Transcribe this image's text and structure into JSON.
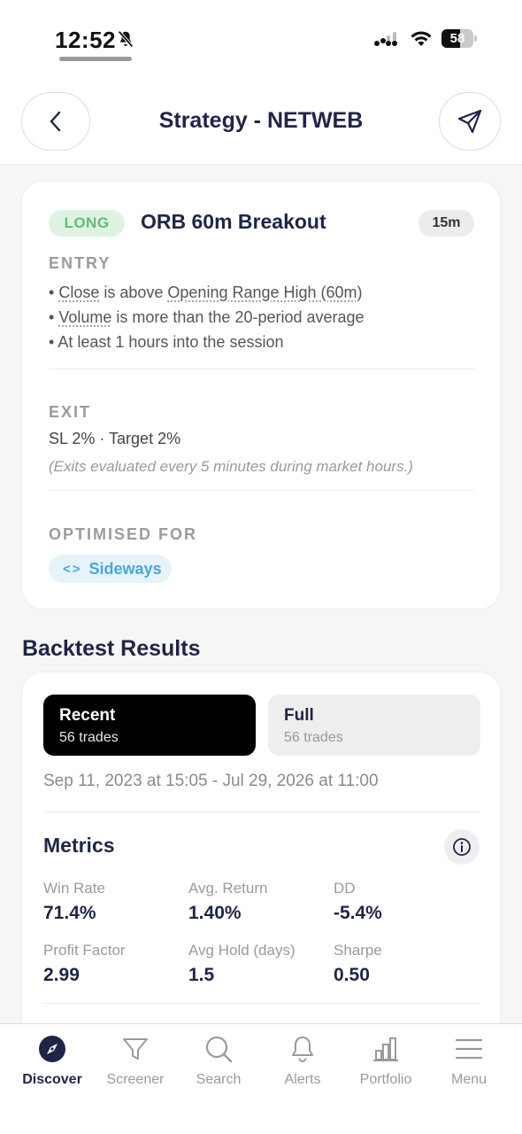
{
  "status_bar": {
    "time": "12:52",
    "battery_level": "58",
    "battery_fraction": 0.58
  },
  "header": {
    "title": "Strategy - NETWEB",
    "back_icon": "chevron-left-icon",
    "share_icon": "send-icon"
  },
  "strategy": {
    "direction": "LONG",
    "name": "ORB 60m Breakout",
    "timeframe": "15m",
    "entry": {
      "label": "ENTRY",
      "rules": [
        {
          "bullet": "•",
          "a": "Close",
          "b": " is above ",
          "c": "Opening Range High (60m)",
          "d": ""
        },
        {
          "bullet": "•",
          "a": "Volume",
          "b": " is more than the 20-period average",
          "c": "",
          "d": ""
        },
        {
          "bullet": "•",
          "a": "",
          "b": "At least 1 hours into the session",
          "c": "",
          "d": ""
        }
      ]
    },
    "exit": {
      "label": "EXIT",
      "text": "SL 2% · Target 2%",
      "note": "(Exits evaluated every 5 minutes during market hours.)"
    },
    "optimised": {
      "label": "OPTIMISED FOR",
      "chip_icon": "<>",
      "chip_label": "Sideways"
    }
  },
  "backtest": {
    "title": "Backtest Results",
    "tabs": [
      {
        "label": "Recent",
        "sub": "56 trades"
      },
      {
        "label": "Full",
        "sub": "56 trades"
      }
    ],
    "date_range": "Sep 11, 2023 at 15:05 - Jul 29, 2026 at 11:00",
    "metrics_title": "Metrics",
    "metrics": [
      {
        "label": "Win Rate",
        "value": "71.4%"
      },
      {
        "label": "Avg. Return",
        "value": "1.40%"
      },
      {
        "label": "DD",
        "value": "-5.4%"
      },
      {
        "label": "Profit Factor",
        "value": "2.99"
      },
      {
        "label": "Avg Hold (days)",
        "value": "1.5"
      },
      {
        "label": "Sharpe",
        "value": "0.50"
      }
    ]
  },
  "nav": {
    "items": [
      {
        "label": "Discover",
        "icon": "compass-icon"
      },
      {
        "label": "Screener",
        "icon": "filter-icon"
      },
      {
        "label": "Search",
        "icon": "search-icon"
      },
      {
        "label": "Alerts",
        "icon": "bell-icon"
      },
      {
        "label": "Portfolio",
        "icon": "bar-chart-icon"
      },
      {
        "label": "Menu",
        "icon": "menu-icon"
      }
    ]
  }
}
